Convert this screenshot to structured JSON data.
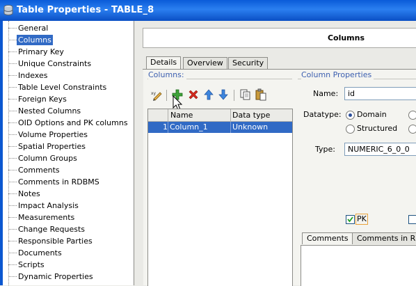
{
  "window": {
    "title": "Table Properties - TABLE_8"
  },
  "tree": {
    "items": [
      {
        "label": "General"
      },
      {
        "label": "Columns",
        "selected": true
      },
      {
        "label": "Primary Key"
      },
      {
        "label": "Unique Constraints"
      },
      {
        "label": "Indexes"
      },
      {
        "label": "Table Level Constraints"
      },
      {
        "label": "Foreign Keys"
      },
      {
        "label": "Nested Columns"
      },
      {
        "label": "OID Options and PK columns"
      },
      {
        "label": "Volume Properties"
      },
      {
        "label": "Spatial Properties"
      },
      {
        "label": "Column Groups"
      },
      {
        "label": "Comments"
      },
      {
        "label": "Comments in RDBMS"
      },
      {
        "label": "Notes"
      },
      {
        "label": "Impact Analysis"
      },
      {
        "label": "Measurements"
      },
      {
        "label": "Change Requests"
      },
      {
        "label": "Responsible Parties"
      },
      {
        "label": "Documents"
      },
      {
        "label": "Scripts"
      },
      {
        "label": "Dynamic Properties"
      }
    ]
  },
  "header": {
    "title": "Columns"
  },
  "tabs": [
    {
      "label": "Details",
      "active": true
    },
    {
      "label": "Overview"
    },
    {
      "label": "Security"
    }
  ],
  "columns_panel": {
    "title": "Columns:",
    "grid": {
      "headers": [
        "Name",
        "Data type"
      ],
      "rows": [
        {
          "index": "1",
          "name": "Column_1",
          "type": "Unknown"
        }
      ]
    }
  },
  "column_props": {
    "title": "Column Properties",
    "name_label": "Name:",
    "name_value": "id",
    "datatype_label": "Datatype:",
    "datatype_options": [
      "Domain",
      "Structured"
    ],
    "datatype_selected": "Domain",
    "type_label": "Type:",
    "type_value": "NUMERIC_6_0_0",
    "pk_label": "PK",
    "pk_checked": true
  },
  "bottom_tabs": [
    {
      "label": "Comments",
      "active": true
    },
    {
      "label": "Comments in RDBMS"
    }
  ],
  "colors": {
    "accent": "#316ac5",
    "titlebar": "#0a5bd8",
    "group_label": "#3c5fb0"
  }
}
